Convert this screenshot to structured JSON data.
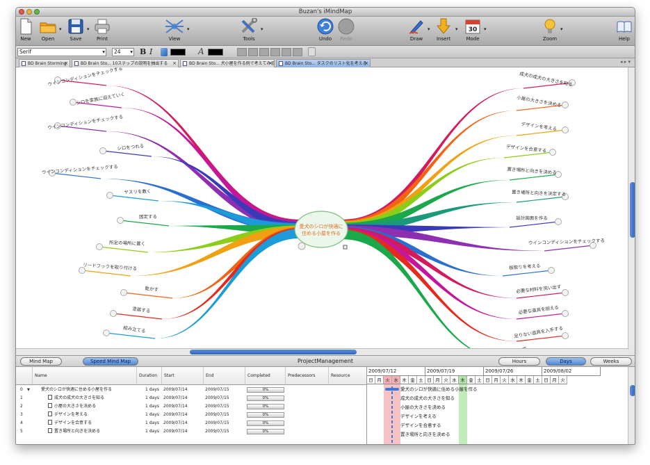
{
  "window": {
    "title": "Buzan's iMindMap"
  },
  "toolbar": {
    "new": "New",
    "open": "Open",
    "save": "Save",
    "print": "Print",
    "view": "View",
    "tools": "Tools",
    "undo": "Undo",
    "redo": "Redo",
    "draw": "Draw",
    "insert": "Insert",
    "mode": "Mode",
    "zoom": "Zoom",
    "help": "Help",
    "mode_icon_text": "30"
  },
  "format": {
    "font": "Serif",
    "size": "24",
    "bold": "B",
    "italic": "I",
    "text_glyph": "A"
  },
  "tabs": [
    {
      "label": "BD Brain Storming"
    },
    {
      "label": "BD Brain Sto... 10ステップの説明を抽出する"
    },
    {
      "label": "BD Brain Sto... 犬小屋を作る例で考えてみる"
    },
    {
      "label": "BD Brain Sto... タスクのリスト化を考える",
      "active": true
    }
  ],
  "mindmap": {
    "central": "愛犬のシロが快適に住める小屋を作る",
    "left_branches": [
      "ウインコンディションをチェックする",
      "シロを家族に迎えていく",
      "ウインコンディションをチェックする",
      "シロをつれる",
      "ウインコンディションをチェックする",
      "ヤスリを敷く",
      "固定する",
      "所定の場所に置く",
      "リードフックを取り付ける",
      "乾かす",
      "塗装する",
      "組み立てる"
    ],
    "right_branches": [
      "成犬の成犬の大きさを知る",
      "小屋の大きさを決める",
      "デザインを考える",
      "デザインを合意する",
      "置き場所と向きを決める",
      "置き場所と向きを決定する",
      "設計図面を作る",
      "ウインコンディションをチェックする",
      "板取りを考える",
      "必要な材料を洗い出す",
      "必要な道具を揃える",
      "足りない道具を入手する",
      "で"
    ]
  },
  "colors": {
    "branches_left": [
      "#d41a5a",
      "#c4169a",
      "#8d2fb0",
      "#3a3ab8",
      "#2a6fd0",
      "#1c9bd8",
      "#1aa84a",
      "#8ccc1a",
      "#f0a010",
      "#f06414",
      "#e42a1e",
      "#1c9bd8",
      "#c4169a"
    ],
    "branches_right": [
      "#d41a5a",
      "#f06414",
      "#f0a010",
      "#8ccc1a",
      "#1aa84a",
      "#1a9a7a",
      "#3a3ab8",
      "#8d2fb0",
      "#2a6fd0",
      "#d41a5a",
      "#c4169a",
      "#e42a1e",
      "#1aa84a"
    ],
    "central_text": "#e66a1a",
    "selection": "#3f78d6"
  },
  "pm": {
    "title": "ProjectManagement",
    "mindmap_btn": "Mind Map",
    "speed_btn": "Speed Mind Map",
    "hours": "Hours",
    "days": "Days",
    "weeks": "Weeks",
    "columns": [
      "Name",
      "Duration",
      "Start",
      "End",
      "Completed",
      "Predecessors",
      "Resource"
    ],
    "rows": [
      {
        "id": "0",
        "toggle": "▼",
        "name": "愛犬のシロが快適に住める小屋を作る",
        "duration": "1 days",
        "start": "2009/07/14",
        "end": "2009/07/15",
        "completed": "0%"
      },
      {
        "id": "1",
        "name": "成犬の成犬の大きさを知る",
        "duration": "1 days",
        "start": "2009/07/14",
        "end": "2009/07/15",
        "completed": "0%"
      },
      {
        "id": "2",
        "name": "小屋の大きさを決める",
        "duration": "1 days",
        "start": "2009/07/14",
        "end": "2009/07/15",
        "completed": "0%"
      },
      {
        "id": "3",
        "name": "デザインを考える",
        "duration": "1 days",
        "start": "2009/07/14",
        "end": "2009/07/15",
        "completed": "0%"
      },
      {
        "id": "4",
        "name": "デザインを合意する",
        "duration": "1 days",
        "start": "2009/07/14",
        "end": "2009/07/15",
        "completed": "0%"
      },
      {
        "id": "5",
        "name": "置き場所と向きを決める",
        "duration": "1 days",
        "start": "2009/07/14",
        "end": "2009/07/15",
        "completed": "0%"
      }
    ]
  },
  "gantt": {
    "weeks": [
      "2009/07/12",
      "2009/07/19",
      "2009/07/26",
      "2009/08/02"
    ],
    "days": [
      "日",
      "月",
      "火",
      "水",
      "木",
      "金",
      "土",
      "日",
      "月",
      "火",
      "水",
      "木",
      "金",
      "土",
      "日",
      "月",
      "火",
      "水",
      "木",
      "金",
      "土",
      "日",
      "月",
      "火"
    ],
    "tasks": [
      "愛犬のシロが快適に住める小屋を作る",
      "成犬の成犬の大きさを知る",
      "小屋の大きさを決める",
      "デザインを考える",
      "デザインを合意する",
      "置き場所と向きを決める"
    ]
  }
}
